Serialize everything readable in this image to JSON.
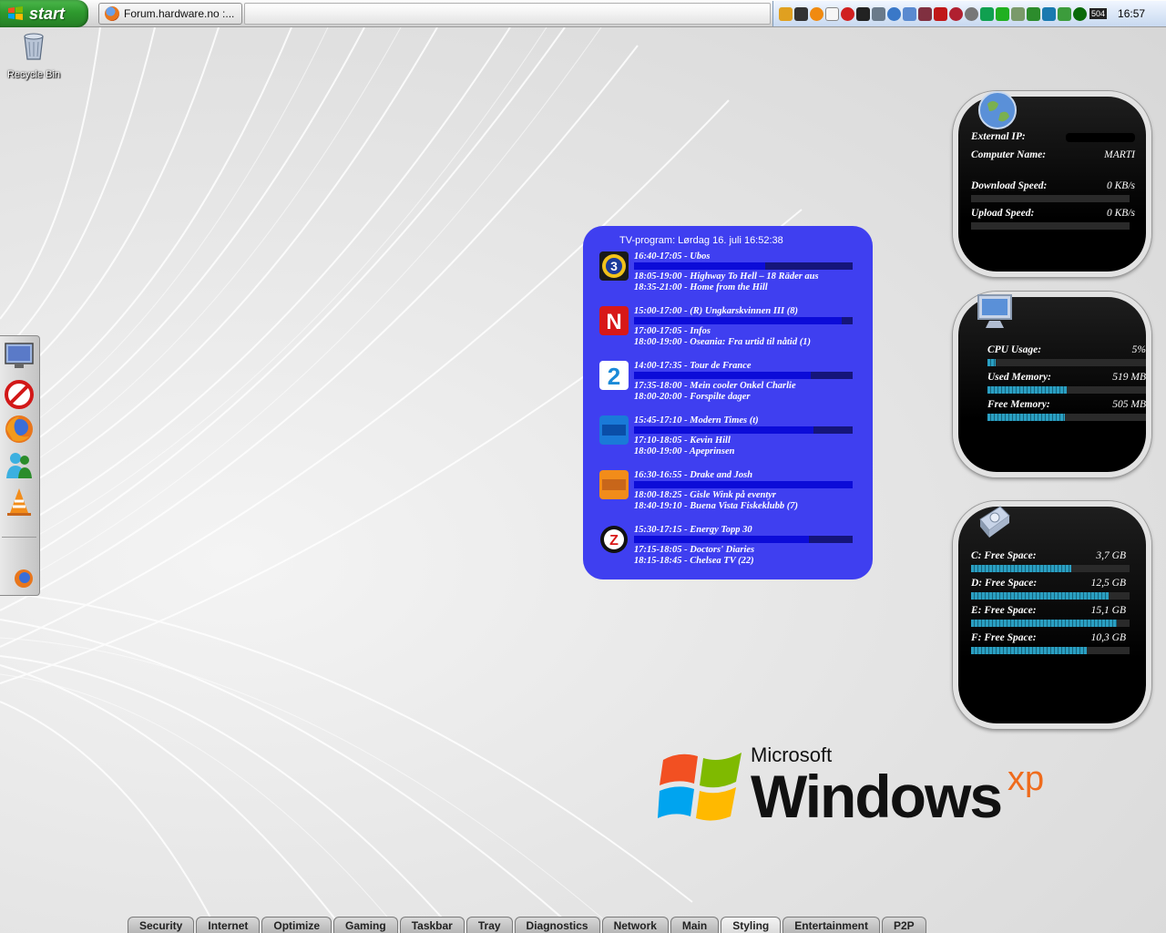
{
  "taskbar": {
    "start_label": "start",
    "task_window_title": "Forum.hardware.no :...",
    "tray_badge": "504",
    "clock": "16:57"
  },
  "desktop": {
    "recycle_bin_label": "Recycle Bin"
  },
  "dock": {
    "items": [
      "display-icon",
      "no-entry-icon",
      "firefox-icon",
      "messenger-icon",
      "vlc-cone-icon"
    ],
    "bottom_item": "firefox-icon"
  },
  "tv_widget": {
    "header": "TV-program: Lørdag 16. juli 16:52:38",
    "channels": [
      {
        "logo": "tv3-logo",
        "now": "16:40-17:05 - Ubos",
        "progress": 0.6,
        "next1": "18:05-19:00 - Highway To Hell – 18 Räder aus",
        "next2": "18:35-21:00 - Home from the Hill"
      },
      {
        "logo": "tvn-logo",
        "now": "15:00-17:00 - (R) Ungkarskvinnen III (8)",
        "progress": 0.95,
        "next1": "17:00-17:05 - Infos",
        "next2": "18:00-19:00 - Oseania: Fra urtid til nåtid (1)"
      },
      {
        "logo": "tv2-logo",
        "now": "14:00-17:35 - Tour de France",
        "progress": 0.81,
        "next1": "17:35-18:00 - Mein cooler Onkel Charlie",
        "next2": "18:00-20:00 - Forspilte dager"
      },
      {
        "logo": "nrk1-logo",
        "now": "15:45-17:10 - Modern Times (t)",
        "progress": 0.82,
        "next1": "17:10-18:05 - Kevin Hill",
        "next2": "18:00-19:00 - Apeprinsen"
      },
      {
        "logo": "nrk2-logo",
        "now": "16:30-16:55 - Drake and Josh",
        "progress": 1.0,
        "next1": "18:00-18:25 - Gisle Wink på eventyr",
        "next2": "18:40-19:10 - Buena Vista Fiskeklubb (7)"
      },
      {
        "logo": "zdf-logo",
        "now": "15:30-17:15 - Energy Topp 30",
        "progress": 0.8,
        "next1": "17:15-18:05 - Doctors' Diaries",
        "next2": "18:15-18:45 - Chelsea TV (22)"
      }
    ]
  },
  "network_gadget": {
    "external_ip_label": "External IP:",
    "computer_name_label": "Computer Name:",
    "computer_name": "MARTI",
    "download_label": "Download Speed:",
    "download_value": "0 KB/s",
    "download_fraction": 0,
    "upload_label": "Upload Speed:",
    "upload_value": "0 KB/s",
    "upload_fraction": 0
  },
  "system_gadget": {
    "cpu_label": "CPU Usage:",
    "cpu_value": "5%",
    "cpu_fraction": 0.05,
    "used_mem_label": "Used Memory:",
    "used_mem_value": "519 MB",
    "used_mem_fraction": 0.5,
    "free_mem_label": "Free Memory:",
    "free_mem_value": "505 MB",
    "free_mem_fraction": 0.49
  },
  "drives_gadget": {
    "drives": [
      {
        "label": "C: Free Space:",
        "value": "3,7 GB",
        "fraction": 0.63
      },
      {
        "label": "D: Free Space:",
        "value": "12,5 GB",
        "fraction": 0.87
      },
      {
        "label": "E: Free Space:",
        "value": "15,1 GB",
        "fraction": 0.92
      },
      {
        "label": "F: Free Space:",
        "value": "10,3 GB",
        "fraction": 0.73
      }
    ]
  },
  "wallpaper": {
    "brand_small": "Microsoft",
    "brand_large": "Windows",
    "brand_suffix": "xp"
  },
  "bottom_tabs": {
    "tabs": [
      "Security",
      "Internet",
      "Optimize",
      "Gaming",
      "Taskbar",
      "Tray",
      "Diagnostics",
      "Network",
      "Main",
      "Styling",
      "Entertainment",
      "P2P"
    ],
    "active": "Styling"
  },
  "colors": {
    "tv_bg": "#3f3ff0",
    "gadget_bar": "#2a9fc2",
    "start_green": "#2e9a2e",
    "xp_orange": "#ef6b1c"
  }
}
